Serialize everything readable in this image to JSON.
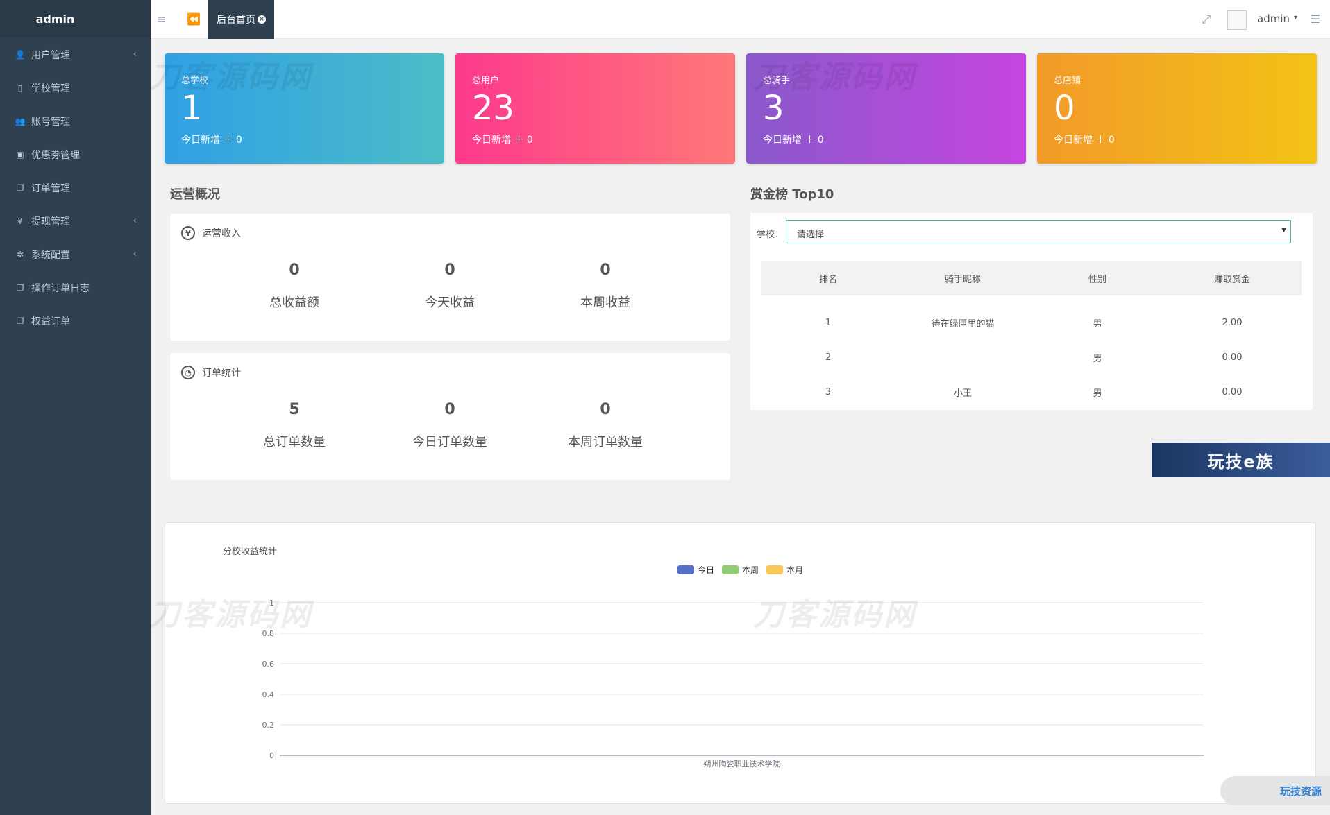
{
  "sidebar": {
    "brand": "admin",
    "items": [
      {
        "label": "用户管理",
        "icon": "user-icon",
        "glyph": "👤",
        "arrow": true
      },
      {
        "label": "学校管理",
        "icon": "building-icon",
        "glyph": "▯",
        "arrow": false
      },
      {
        "label": "账号管理",
        "icon": "users-icon",
        "glyph": "👥",
        "arrow": false
      },
      {
        "label": "优惠劵管理",
        "icon": "money-icon",
        "glyph": "▣",
        "arrow": false
      },
      {
        "label": "订单管理",
        "icon": "copy-icon",
        "glyph": "❐",
        "arrow": false
      },
      {
        "label": "提现管理",
        "icon": "yen-icon",
        "glyph": "¥",
        "arrow": true
      },
      {
        "label": "系统配置",
        "icon": "gear-icon",
        "glyph": "✲",
        "arrow": true
      },
      {
        "label": "操作订单日志",
        "icon": "copy-icon",
        "glyph": "❐",
        "arrow": false
      },
      {
        "label": "权益订单",
        "icon": "copy-icon",
        "glyph": "❐",
        "arrow": false
      }
    ]
  },
  "topbar": {
    "tab_label": "后台首页",
    "tab_close": "×",
    "user": "admin",
    "caret": "▾"
  },
  "cards": [
    {
      "title": "总学校",
      "value": "1",
      "sub": "今日新增 ＋ 0"
    },
    {
      "title": "总用户",
      "value": "23",
      "sub": "今日新增 ＋ 0"
    },
    {
      "title": "总骑手",
      "value": "3",
      "sub": "今日新增 ＋ 0"
    },
    {
      "title": "总店铺",
      "value": "0",
      "sub": "今日新增 ＋ 0"
    }
  ],
  "ops": {
    "title": "运营概况",
    "income": {
      "header": "运营收入",
      "items": [
        {
          "value": "0",
          "label": "总收益额"
        },
        {
          "value": "0",
          "label": "今天收益"
        },
        {
          "value": "0",
          "label": "本周收益"
        }
      ]
    },
    "orders": {
      "header": "订单统计",
      "items": [
        {
          "value": "5",
          "label": "总订单数量"
        },
        {
          "value": "0",
          "label": "今日订单数量"
        },
        {
          "value": "0",
          "label": "本周订单数量"
        }
      ]
    }
  },
  "leaderboard": {
    "title": "赏金榜 Top10",
    "school_label": "学校：",
    "select_value": "请选择",
    "columns": [
      "排名",
      "骑手昵称",
      "性别",
      "赚取赏金"
    ],
    "rows": [
      [
        "1",
        "待在绿匣里的猫",
        "男",
        "2.00"
      ],
      [
        "2",
        "",
        "男",
        "0.00"
      ],
      [
        "3",
        "小王",
        "男",
        "0.00"
      ]
    ]
  },
  "banner_text": "玩技e族",
  "float_button": "玩技资源",
  "watermark_text": "刀客源码网",
  "chart_data": {
    "type": "bar",
    "title": "分校收益统计",
    "categories": [
      "朔州陶瓷职业技术学院"
    ],
    "series": [
      {
        "name": "今日",
        "values": [
          0
        ],
        "color": "#5470c6"
      },
      {
        "name": "本周",
        "values": [
          0
        ],
        "color": "#91cc75"
      },
      {
        "name": "本月",
        "values": [
          0
        ],
        "color": "#fac858"
      }
    ],
    "yticks": [
      "0",
      "0.2",
      "0.4",
      "0.6",
      "0.8",
      "1"
    ],
    "ylim": [
      0,
      1
    ],
    "grid": true,
    "legend": "top-center"
  }
}
